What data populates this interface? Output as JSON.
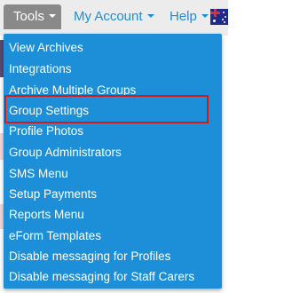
{
  "nav": {
    "tools_label": "Tools",
    "account_label": "My Account",
    "help_label": "Help"
  },
  "menu": {
    "items": [
      {
        "label": "View Archives"
      },
      {
        "label": "Integrations"
      },
      {
        "label": "Archive Multiple Groups"
      },
      {
        "label": "Group Settings",
        "highlighted": true
      },
      {
        "label": "Profile Photos"
      },
      {
        "label": "Group Administrators"
      },
      {
        "label": "SMS Menu"
      },
      {
        "label": "Setup Payments"
      },
      {
        "label": "Reports Menu"
      },
      {
        "label": "eForm Templates"
      },
      {
        "label": "Disable messaging for Profiles"
      },
      {
        "label": "Disable messaging for Staff Carers"
      }
    ]
  },
  "colors": {
    "menu_background": "#1c8fd8",
    "highlight_border": "#d21a1a",
    "tools_active": "#898989",
    "link": "#1c8fd8"
  },
  "icons": [
    "chevron-down-icon",
    "australia-flag-icon"
  ]
}
